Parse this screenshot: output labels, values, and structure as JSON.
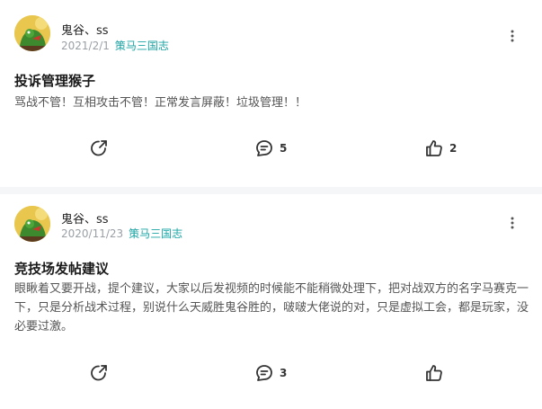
{
  "posts": [
    {
      "author": "鬼谷、ss",
      "date": "2021/2/1",
      "board": "策马三国志",
      "title": "投诉管理猴子",
      "body": "骂战不管！互相攻击不管！正常发言屏蔽！垃圾管理！！",
      "comment_count": "5",
      "like_count": "2"
    },
    {
      "author": "鬼谷、ss",
      "date": "2020/11/23",
      "board": "策马三国志",
      "title": "竞技场发帖建议",
      "body": "眼瞅着又要开战，提个建议，大家以后发视频的时候能不能稍微处理下，把对战双方的名字马赛克一下，只是分析战术过程，别说什么天威胜鬼谷胜的，啵啵大佬说的对，只是虚拟工会，都是玩家，没必要过激。",
      "comment_count": "3",
      "like_count": ""
    }
  ],
  "icons": {
    "share": "share-icon",
    "comment": "comment-icon",
    "like": "thumbs-up-icon",
    "more": "more-vertical-icon"
  },
  "colors": {
    "accent_board": "#1aa3a3",
    "meta_gray": "#9aa0a6",
    "icon_gray": "#333333"
  }
}
